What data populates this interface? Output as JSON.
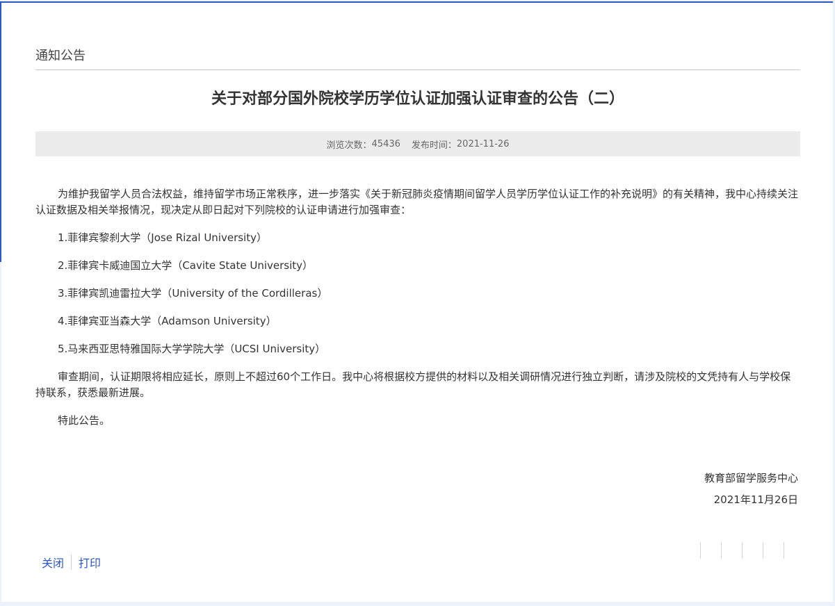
{
  "section": {
    "title": "通知公告"
  },
  "article": {
    "title": "关于对部分国外院校学历学位认证加强认证审查的公告（二）",
    "meta": {
      "views_label": "浏览次数：",
      "views": "45436",
      "date_label": "发布时间：",
      "date": "2021-11-26"
    },
    "intro": "为维护我留学人员合法权益，维持留学市场正常秩序，进一步落实《关于新冠肺炎疫情期间留学人员学历学位认证工作的补充说明》的有关精神，我中心持续关注认证数据及相关举报情况，现决定从即日起对下列院校的认证申请进行加强审查：",
    "schools": [
      "1.菲律宾黎刹大学（Jose Rizal University）",
      "2.菲律宾卡威迪国立大学（Cavite State University）",
      "3.菲律宾凯迪雷拉大学（University of the Cordilleras）",
      "4.菲律宾亚当森大学（Adamson University）",
      "5.马来西亚思特雅国际大学学院大学（UCSI University）"
    ],
    "review_note": "审查期间，认证期限将相应延长，原则上不超过60个工作日。我中心将根据校方提供的材料以及相关调研情况进行独立判断，请涉及院校的文凭持有人与学校保持联系，获悉最新进展。",
    "closing": "特此公告。",
    "signature": {
      "org": "教育部留学服务中心",
      "date": "2021年11月26日"
    }
  },
  "actions": {
    "close_label": "关闭",
    "print_label": "打印"
  },
  "colors": {
    "accent": "#2a56c6",
    "meta_bg": "#ececec",
    "text": "#333333"
  }
}
